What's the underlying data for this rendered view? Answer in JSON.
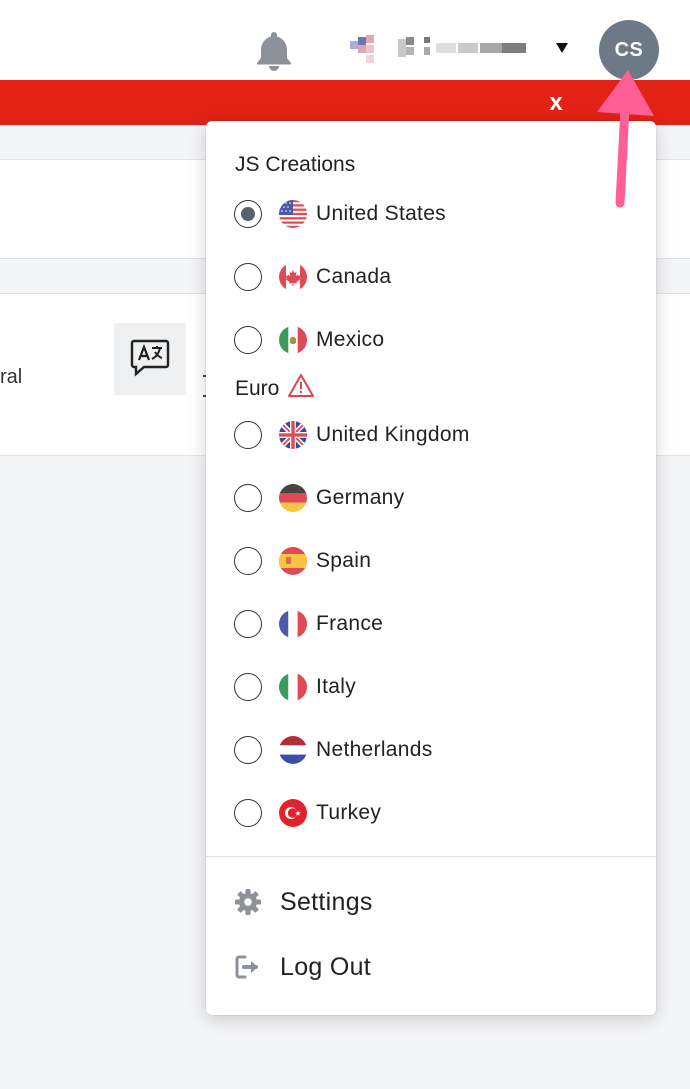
{
  "header": {
    "avatar_initials": "CS",
    "banner_close": "x"
  },
  "background": {
    "partial_text": "ral"
  },
  "dropdown": {
    "groups": [
      {
        "title": "JS Creations",
        "warning": false,
        "options": [
          {
            "label": "United States",
            "flag": "us",
            "selected": true
          },
          {
            "label": "Canada",
            "flag": "ca",
            "selected": false
          },
          {
            "label": "Mexico",
            "flag": "mx",
            "selected": false
          }
        ]
      },
      {
        "title": "Euro",
        "warning": true,
        "options": [
          {
            "label": "United Kingdom",
            "flag": "gb",
            "selected": false
          },
          {
            "label": "Germany",
            "flag": "de",
            "selected": false
          },
          {
            "label": "Spain",
            "flag": "es",
            "selected": false
          },
          {
            "label": "France",
            "flag": "fr",
            "selected": false
          },
          {
            "label": "Italy",
            "flag": "it",
            "selected": false
          },
          {
            "label": "Netherlands",
            "flag": "nl",
            "selected": false
          },
          {
            "label": "Turkey",
            "flag": "tr",
            "selected": false
          }
        ]
      }
    ],
    "menu": {
      "settings": "Settings",
      "logout": "Log Out"
    }
  },
  "colors": {
    "banner": "#e32216",
    "avatar": "#6b7a86",
    "annotation_arrow": "#ff5f95",
    "warning": "#e0454f"
  },
  "icons": {
    "bell": "bell-icon",
    "caret": "caret-down-icon",
    "translate": "translate-icon",
    "warning": "warning-icon",
    "settings": "gear-icon",
    "logout": "logout-icon"
  }
}
